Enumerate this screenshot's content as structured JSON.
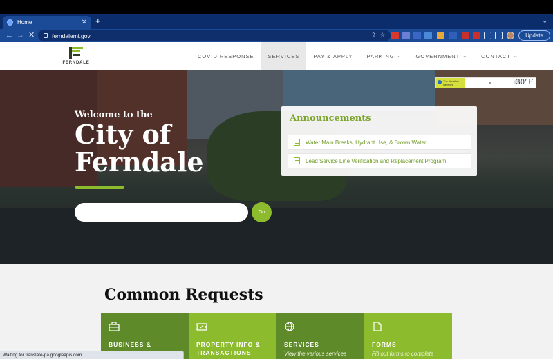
{
  "browser": {
    "tab_title": "Home",
    "url": "ferndalemi.gov",
    "update_label": "Update",
    "new_tab": "+",
    "tab_close": "✕",
    "back": "←",
    "forward": "→",
    "reload": "✕",
    "tab_menu": "⌄",
    "share_icon": "⇪",
    "star_icon": "☆",
    "status_text": "Waiting for translate-pa.googleapis.com...",
    "extension_colors": [
      "#d8382e",
      "#6b7fd7",
      "#3a67c5",
      "#4a88d8",
      "#e4a93a",
      "#2f5fb8",
      "#c9302c"
    ]
  },
  "site": {
    "logo_text": "FERNDALE",
    "brand_green": "#8dbb2e",
    "nav": [
      {
        "label": "COVID RESPONSE",
        "caret": ""
      },
      {
        "label": "SERVICES",
        "caret": ""
      },
      {
        "label": "PAY & APPLY",
        "caret": ""
      },
      {
        "label": "PARKING",
        "caret": "⌄"
      },
      {
        "label": "GOVERNMENT",
        "caret": "⌄"
      },
      {
        "label": "CONTACT",
        "caret": "⌄"
      }
    ]
  },
  "hero": {
    "welcome": "Welcome to the",
    "city_line1": "City of",
    "city_line2": "Ferndale",
    "search_placeholder": "",
    "go_label": "Go"
  },
  "weather": {
    "network": "The Weather Network",
    "temp": "30°F"
  },
  "announcements": {
    "title": "Announcements",
    "items": [
      "Water Main Breaks, Hydrant Use, & Brown Water",
      "Lead Service Line Verification and Replacement Program"
    ]
  },
  "common_requests": {
    "title": "Common Requests",
    "cards": [
      {
        "title": "BUSINESS & DEVELOPMENT",
        "desc": "",
        "icon": "briefcase-icon",
        "color": "#5e8a2a"
      },
      {
        "title": "PROPERTY INFO & TRANSACTIONS",
        "desc": "",
        "icon": "ticket-icon",
        "color": "#8dbb2e"
      },
      {
        "title": "SERVICES",
        "desc": "View the various services",
        "icon": "globe-icon",
        "color": "#5e8a2a"
      },
      {
        "title": "FORMS",
        "desc": "Fill out forms to complete",
        "icon": "document-icon",
        "color": "#8dbb2e"
      }
    ]
  }
}
